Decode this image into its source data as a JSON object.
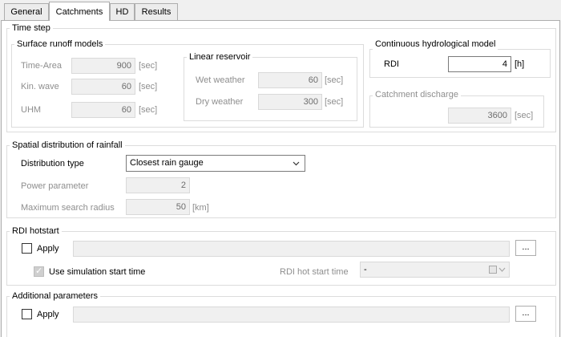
{
  "tabs": [
    {
      "label": "General"
    },
    {
      "label": "Catchments"
    },
    {
      "label": "HD"
    },
    {
      "label": "Results"
    }
  ],
  "time_step": {
    "title": "Time step",
    "surface_runoff": {
      "title": "Surface runoff models",
      "time_area": {
        "label": "Time-Area",
        "value": "900",
        "unit": "[sec]"
      },
      "kin_wave": {
        "label": "Kin. wave",
        "value": "60",
        "unit": "[sec]"
      },
      "uhm": {
        "label": "UHM",
        "value": "60",
        "unit": "[sec]"
      }
    },
    "linear_reservoir": {
      "title": "Linear reservoir",
      "wet": {
        "label": "Wet weather",
        "value": "60",
        "unit": "[sec]"
      },
      "dry": {
        "label": "Dry weather",
        "value": "300",
        "unit": "[sec]"
      }
    },
    "continuous": {
      "title": "Continuous hydrological model",
      "rdi": {
        "label": "RDI",
        "value": "4",
        "unit": "[h]"
      }
    },
    "catchment_discharge": {
      "title": "Catchment discharge",
      "value": "3600",
      "unit": "[sec]"
    }
  },
  "spatial": {
    "title": "Spatial distribution of rainfall",
    "distribution": {
      "label": "Distribution type",
      "value": "Closest rain gauge"
    },
    "power": {
      "label": "Power parameter",
      "value": "2"
    },
    "radius": {
      "label": "Maximum search radius",
      "value": "50",
      "unit": "[km]"
    }
  },
  "rdi_hotstart": {
    "title": "RDI hotstart",
    "apply_label": "Apply",
    "browse_label": "...",
    "use_sim_label": "Use simulation start time",
    "start_time_label": "RDI hot start time",
    "start_time_value": "-"
  },
  "additional": {
    "title": "Additional parameters",
    "apply_label": "Apply",
    "browse_label": "..."
  }
}
